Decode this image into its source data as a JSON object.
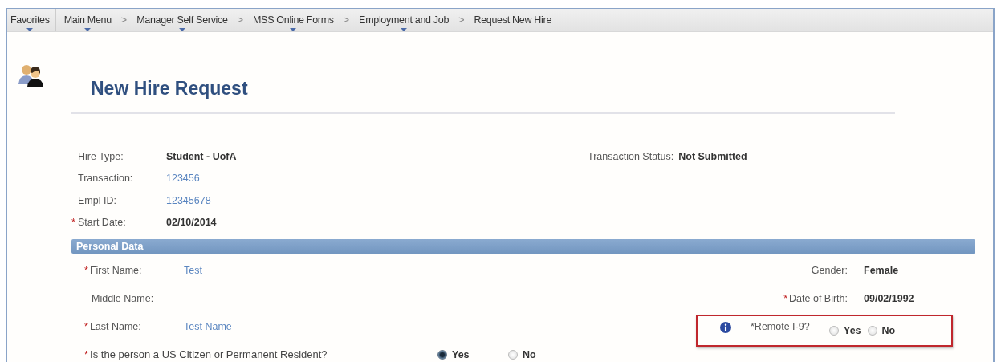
{
  "breadcrumb": [
    {
      "label": "Favorites",
      "dropdown": true,
      "divider": true
    },
    {
      "label": "Main Menu",
      "dropdown": true,
      "separator": ">"
    },
    {
      "label": "Manager Self Service",
      "dropdown": true,
      "separator": ">"
    },
    {
      "label": "MSS Online Forms",
      "dropdown": true,
      "separator": ">"
    },
    {
      "label": "Employment and Job",
      "dropdown": true,
      "separator": ">"
    },
    {
      "label": "Request New Hire",
      "dropdown": false
    }
  ],
  "page_title": "New Hire Request",
  "header_fields": [
    {
      "label": "Hire Type:",
      "value": "Student - UofA",
      "kind": "bold"
    },
    {
      "label": "Transaction:",
      "value": "123456",
      "kind": "link"
    },
    {
      "label": "Empl ID:",
      "value": "12345678",
      "kind": "link"
    },
    {
      "label": "Start Date:",
      "value": "02/10/2014",
      "kind": "bold",
      "mark": "*"
    }
  ],
  "transaction_status": {
    "label": "Transaction Status:",
    "value": "Not Submitted"
  },
  "section": {
    "title": "Personal Data"
  },
  "personal_left": [
    {
      "label": "First Name:",
      "value": "Test",
      "mark": "*"
    },
    {
      "label": "Middle Name:"
    },
    {
      "label": "Last Name:",
      "value": "Test Name",
      "mark": "*"
    }
  ],
  "citizen_question": {
    "mark": "*",
    "label": "Is the person a US Citizen or Permanent Resident?",
    "options": [
      {
        "label": "Yes",
        "selected": true
      },
      {
        "label": "No",
        "selected": false
      }
    ]
  },
  "personal_right": [
    {
      "label": "Gender:",
      "value": "Female"
    },
    {
      "label": "Date of Birth:",
      "value": "09/02/1992",
      "mark": "*"
    }
  ],
  "remote_i9": {
    "label": "*Remote I-9?",
    "highlighted": true,
    "options": [
      {
        "label": "Yes",
        "selected": false
      },
      {
        "label": "No",
        "selected": false
      }
    ]
  }
}
